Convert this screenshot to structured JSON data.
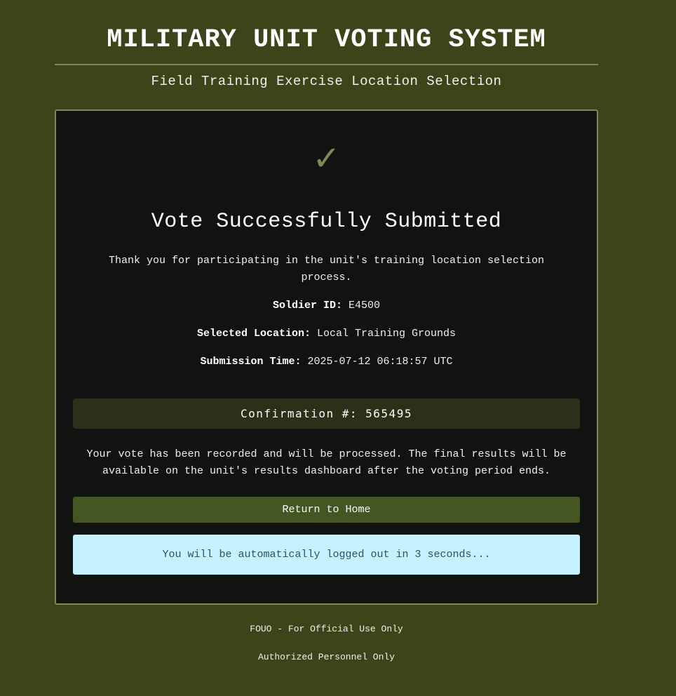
{
  "header": {
    "title": "MILITARY UNIT VOTING SYSTEM",
    "subtitle": "Field Training Exercise Location Selection"
  },
  "confirmation": {
    "check_icon": "✓",
    "title": "Vote Successfully Submitted",
    "thanks": "Thank you for participating in the unit's training location selection process.",
    "details": [
      {
        "label": "Soldier ID:",
        "value": "E4500"
      },
      {
        "label": "Selected Location:",
        "value": "Local Training Grounds"
      },
      {
        "label": "Submission Time:",
        "value": "2025-07-12 06:18:57 UTC"
      }
    ],
    "confirmation_number": "Confirmation #: 565495",
    "processing_note": "Your vote has been recorded and will be processed. The final results will be available on the unit's results dashboard after the voting period ends.",
    "home_button_label": "Return to Home",
    "logout_notice": "You will be automatically logged out in 3 seconds..."
  },
  "footer": {
    "classification": "FOUO - For Official Use Only",
    "access": "Authorized Personnel Only"
  },
  "colors": {
    "background": "#3b4519",
    "card": "#111310",
    "accent": "#7d8b52",
    "button": "#435624",
    "alert_bg": "#c8f1ff",
    "alert_text": "#1e5667"
  }
}
